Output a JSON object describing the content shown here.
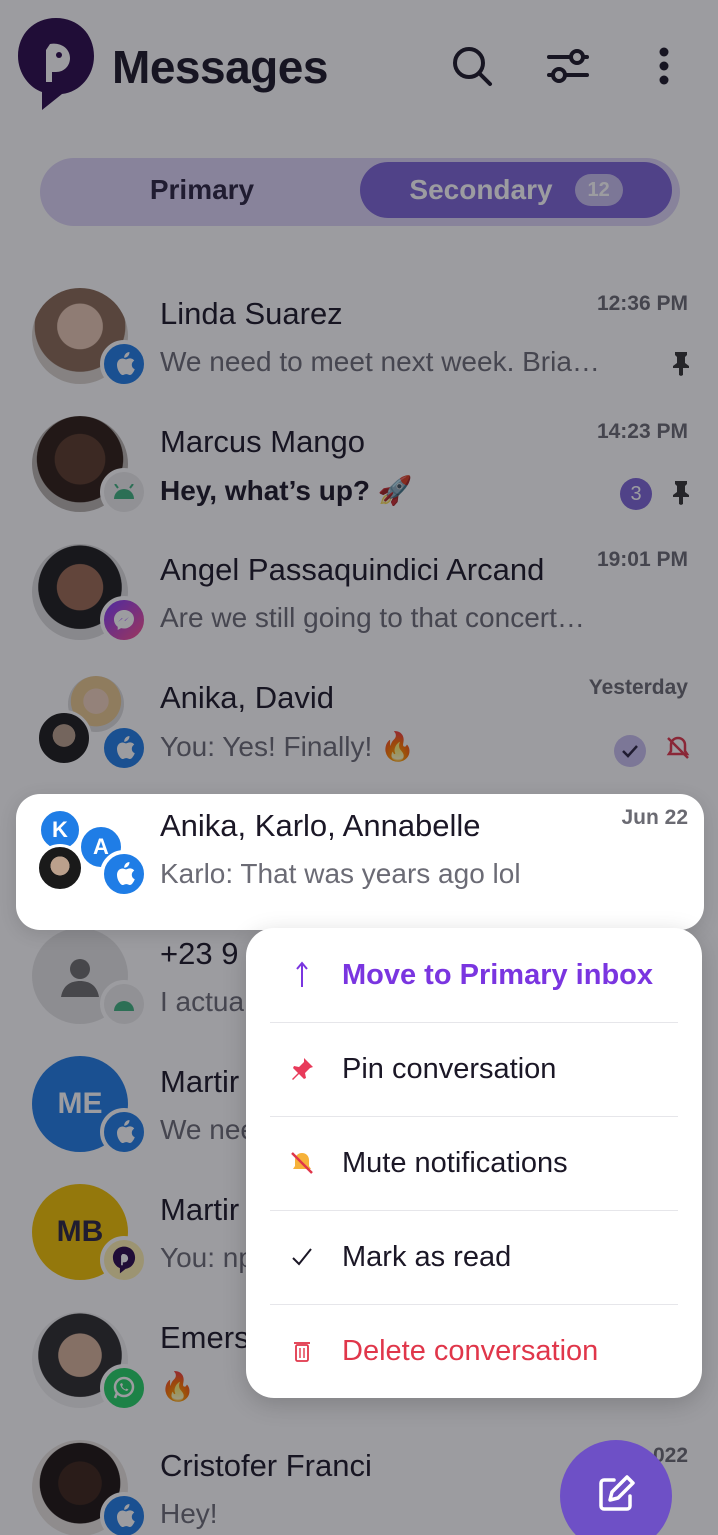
{
  "header": {
    "title": "Messages"
  },
  "tabs": {
    "primary": "Primary",
    "secondary": "Secondary",
    "secondary_count": "12"
  },
  "conversations": [
    {
      "name": "Linda Suarez",
      "preview": "We need to meet next week. Bria…",
      "time": "12:36 PM",
      "platform": "apple",
      "pinned": true
    },
    {
      "name": "Marcus Mango",
      "preview": "Hey, what’s up? 🚀",
      "time": "14:23 PM",
      "platform": "android",
      "unread": "3",
      "pinned": true
    },
    {
      "name": "Angel Passaquindici Arcand",
      "preview": "Are we still going to that concert…",
      "time": "19:01 PM",
      "platform": "messenger"
    },
    {
      "name": "Anika, David",
      "preview": "You: Yes! Finally! 🔥",
      "time": "Yesterday",
      "platform": "apple",
      "read": true,
      "muted": true
    },
    {
      "name": "Anika, Karlo, Annabelle",
      "preview": "Karlo: That was years ago lol",
      "time": "Jun 22",
      "platform": "apple",
      "initial_k": "K",
      "initial_a": "A"
    },
    {
      "name": "+23 9",
      "preview": "I actua",
      "platform": "android"
    },
    {
      "name": "Martir",
      "preview": "We nee",
      "platform": "apple",
      "initials": "ME"
    },
    {
      "name": "Martir",
      "preview": "You: np",
      "platform": "app",
      "initials": "MB"
    },
    {
      "name": "Emers",
      "preview": "🔥",
      "platform": "whatsapp"
    },
    {
      "name": "Cristofer Franci",
      "preview": "Hey!",
      "time": "A…022",
      "platform": "apple"
    }
  ],
  "context_menu": {
    "items": [
      {
        "label": "Move to Primary inbox",
        "icon": "arrow-up-icon"
      },
      {
        "label": "Pin conversation",
        "icon": "pin-icon"
      },
      {
        "label": "Mute notifications",
        "icon": "bell-off-icon"
      },
      {
        "label": "Mark as read",
        "icon": "check-icon"
      },
      {
        "label": "Delete conversation",
        "icon": "trash-icon"
      }
    ]
  },
  "colors": {
    "accent": "#6e50c6",
    "danger": "#e0364a",
    "primary_action": "#7a35e0"
  }
}
